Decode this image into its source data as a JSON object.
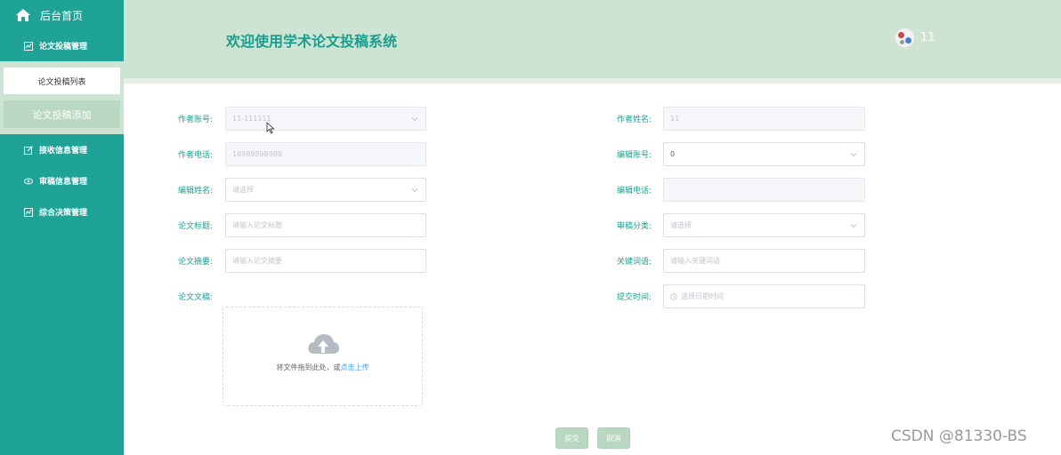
{
  "sidebar": {
    "home_label": "后台首页",
    "menus": [
      {
        "label": "论文投稿管理",
        "icon": "chart-icon"
      },
      {
        "label": "接收信息管理",
        "icon": "edit-icon"
      },
      {
        "label": "审稿信息管理",
        "icon": "eye-icon"
      },
      {
        "label": "综合决策管理",
        "icon": "chart-icon"
      }
    ],
    "submenu": [
      {
        "label": "论文投稿列表"
      },
      {
        "label": "论文投稿添加"
      }
    ]
  },
  "header": {
    "title": "欢迎使用学术论文投稿系统",
    "username": "11"
  },
  "form": {
    "author_account": {
      "label": "作者账号:",
      "value": "11-111111"
    },
    "author_name": {
      "label": "作者姓名:",
      "value": "11"
    },
    "author_phone": {
      "label": "作者电话:",
      "value": "18989898989"
    },
    "editor_account": {
      "label": "编辑账号:",
      "value": "0"
    },
    "editor_name": {
      "label": "编辑姓名:",
      "placeholder": "请选择"
    },
    "editor_phone": {
      "label": "编辑电话:",
      "value": ""
    },
    "paper_title": {
      "label": "论文标题:",
      "placeholder": "请输入论文标题"
    },
    "review_category": {
      "label": "审稿分类:",
      "placeholder": "请选择"
    },
    "paper_abstract": {
      "label": "论文摘要:",
      "placeholder": "请输入论文摘要"
    },
    "keywords": {
      "label": "关键词语:",
      "placeholder": "请输入关键词语"
    },
    "paper_file": {
      "label": "论文文稿:"
    },
    "submit_time": {
      "label": "提交时间:",
      "placeholder": "选择日期时间"
    },
    "upload": {
      "text": "将文件拖到此处，或",
      "link": "点击上传"
    },
    "submit_label": "提交",
    "cancel_label": "取消"
  },
  "watermark": "CSDN @81330-BS",
  "colors": {
    "sidebar": "#1ea396",
    "header": "#cde4d2",
    "accent_text": "#1a9e8f",
    "button": "#bad7c2"
  }
}
